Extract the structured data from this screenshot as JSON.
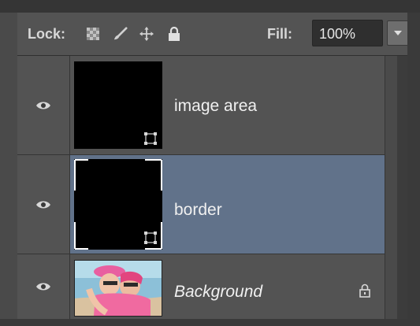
{
  "lock": {
    "label": "Lock:",
    "icons": [
      "lock-transparent-pixels-icon",
      "lock-image-pixels-icon",
      "lock-position-icon",
      "lock-all-icon"
    ]
  },
  "fill": {
    "label": "Fill:",
    "value": "100%"
  },
  "layers": [
    {
      "name": "image area",
      "visible": true,
      "selected": false,
      "italic": false,
      "locked": false,
      "thumbnail": "black-fill-with-transform-icon"
    },
    {
      "name": "border",
      "visible": true,
      "selected": true,
      "italic": false,
      "locked": false,
      "thumbnail": "black-fill-with-frame-corners"
    },
    {
      "name": "Background",
      "visible": true,
      "selected": false,
      "italic": true,
      "locked": true,
      "thumbnail": "photo-two-girls"
    }
  ],
  "colors": {
    "panel": "#535353",
    "selected_row": "#61728a",
    "text": "#f0f0f0"
  }
}
